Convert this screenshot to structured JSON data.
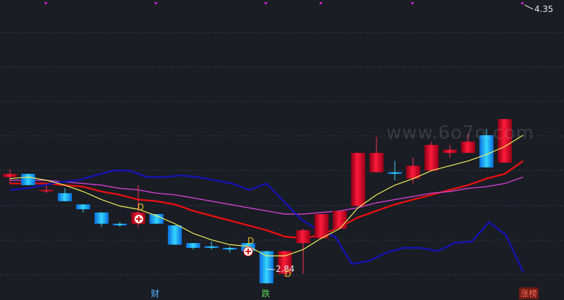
{
  "watermark": "www.6o7o.com",
  "markers": {
    "max_label": "4.35",
    "min_label": "2.84",
    "d_label": "D"
  },
  "bottom_labels": [
    {
      "text": "财",
      "color": "#5ab4ff"
    },
    {
      "text": "跌",
      "color": "#5cdc5c"
    },
    {
      "text": "涨榜",
      "color": "#ff6a5a",
      "bg": "#6b1a14"
    }
  ],
  "colors": {
    "up": "#e8102a",
    "down": "#1aa6ff",
    "ma_yellow": "#f2f25a",
    "ma_red": "#e81010",
    "ma_magenta": "#d040d0",
    "ma_blue": "#1414b4",
    "grid": "#3a3e48",
    "top_ticks": "#e020e0"
  },
  "chart_data": {
    "type": "candlestick",
    "ylim": [
      2.7,
      4.45
    ],
    "grid": "dashed horizontal",
    "candles": [
      {
        "o": 3.35,
        "h": 3.4,
        "l": 3.31,
        "c": 3.37
      },
      {
        "o": 3.37,
        "h": 3.37,
        "l": 3.3,
        "c": 3.3
      },
      {
        "o": 3.27,
        "h": 3.3,
        "l": 3.25,
        "c": 3.27
      },
      {
        "o": 3.25,
        "h": 3.28,
        "l": 3.2,
        "c": 3.2
      },
      {
        "o": 3.18,
        "h": 3.18,
        "l": 3.13,
        "c": 3.15
      },
      {
        "o": 3.13,
        "h": 3.13,
        "l": 3.04,
        "c": 3.06
      },
      {
        "o": 3.06,
        "h": 3.07,
        "l": 3.04,
        "c": 3.05
      },
      {
        "o": 3.06,
        "h": 3.3,
        "l": 3.04,
        "c": 3.13
      },
      {
        "o": 3.12,
        "h": 3.12,
        "l": 3.06,
        "c": 3.06
      },
      {
        "o": 3.05,
        "h": 3.05,
        "l": 2.93,
        "c": 2.93
      },
      {
        "o": 2.94,
        "h": 2.94,
        "l": 2.9,
        "c": 2.91
      },
      {
        "o": 2.92,
        "h": 2.95,
        "l": 2.9,
        "c": 2.91
      },
      {
        "o": 2.91,
        "h": 2.92,
        "l": 2.88,
        "c": 2.9
      },
      {
        "o": 2.94,
        "h": 2.94,
        "l": 2.89,
        "c": 2.89
      },
      {
        "o": 2.89,
        "h": 2.89,
        "l": 2.69,
        "c": 2.69
      },
      {
        "o": 2.75,
        "h": 2.89,
        "l": 2.73,
        "c": 2.89
      },
      {
        "o": 2.94,
        "h": 3.03,
        "l": 2.75,
        "c": 3.02
      },
      {
        "o": 2.97,
        "h": 3.12,
        "l": 2.97,
        "c": 3.12
      },
      {
        "o": 3.03,
        "h": 3.14,
        "l": 3.03,
        "c": 3.14
      },
      {
        "o": 3.17,
        "h": 3.5,
        "l": 3.17,
        "c": 3.5
      },
      {
        "o": 3.38,
        "h": 3.6,
        "l": 3.38,
        "c": 3.5
      },
      {
        "o": 3.38,
        "h": 3.45,
        "l": 3.33,
        "c": 3.37
      },
      {
        "o": 3.34,
        "h": 3.47,
        "l": 3.31,
        "c": 3.42
      },
      {
        "o": 3.39,
        "h": 3.57,
        "l": 3.39,
        "c": 3.55
      },
      {
        "o": 3.5,
        "h": 3.55,
        "l": 3.47,
        "c": 3.52
      },
      {
        "o": 3.5,
        "h": 3.62,
        "l": 3.5,
        "c": 3.57
      },
      {
        "o": 3.61,
        "h": 3.65,
        "l": 3.41,
        "c": 3.41
      },
      {
        "o": 3.44,
        "h": 3.71,
        "l": 3.44,
        "c": 3.71
      }
    ],
    "series": [
      {
        "color": "ma_yellow",
        "values": [
          3.34,
          3.35,
          3.33,
          3.3,
          3.26,
          3.21,
          3.17,
          3.15,
          3.11,
          3.06,
          3.0,
          2.96,
          2.93,
          2.92,
          2.86,
          2.86,
          2.9,
          2.97,
          3.03,
          3.16,
          3.24,
          3.3,
          3.34,
          3.39,
          3.42,
          3.45,
          3.49,
          3.54,
          3.61
        ]
      },
      {
        "color": "ma_red",
        "values": [
          3.31,
          3.31,
          3.31,
          3.3,
          3.29,
          3.26,
          3.24,
          3.21,
          3.2,
          3.18,
          3.14,
          3.11,
          3.08,
          3.05,
          3.02,
          2.98,
          2.97,
          2.99,
          3.04,
          3.1,
          3.14,
          3.18,
          3.21,
          3.24,
          3.27,
          3.3,
          3.34,
          3.37,
          3.45
        ]
      },
      {
        "color": "ma_magenta",
        "values": [
          3.33,
          3.33,
          3.33,
          3.32,
          3.31,
          3.3,
          3.28,
          3.27,
          3.25,
          3.24,
          3.22,
          3.2,
          3.18,
          3.16,
          3.14,
          3.12,
          3.12,
          3.13,
          3.14,
          3.16,
          3.19,
          3.21,
          3.23,
          3.25,
          3.26,
          3.28,
          3.29,
          3.31,
          3.35
        ]
      },
      {
        "color": "ma_blue",
        "values": [
          3.27,
          3.28,
          3.3,
          3.32,
          3.33,
          3.36,
          3.39,
          3.39,
          3.35,
          3.35,
          3.36,
          3.35,
          3.33,
          3.31,
          3.27,
          3.31,
          3.2,
          3.09,
          3.02,
          2.98,
          2.81,
          2.83,
          2.88,
          2.91,
          2.91,
          2.89,
          2.94,
          2.95,
          3.07,
          2.99,
          2.76
        ]
      }
    ]
  }
}
